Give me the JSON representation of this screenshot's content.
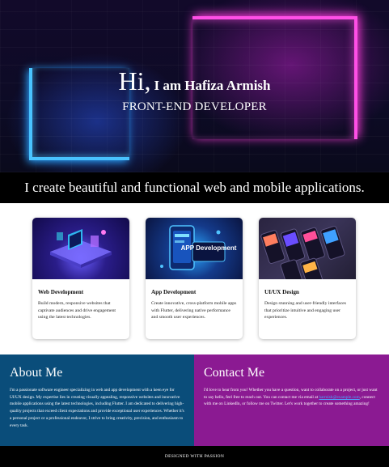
{
  "hero": {
    "greeting": "Hi,",
    "name": "I am Hafiza Armish",
    "role": "FRONT-END DEVELOPER"
  },
  "tagline": "I create beautiful and functional web and mobile applications.",
  "services": [
    {
      "title": "Web Development",
      "description": "Build modern, responsive websites that captivate audiences and drive engagement using the latest technologies."
    },
    {
      "title": "App Development",
      "description": "Create innovative, cross-platform mobile apps with Flutter, delivering native performance and smooth user experiences.",
      "image_text": "APP Development"
    },
    {
      "title": "UI/UX Design",
      "description": "Design stunning and user-friendly interfaces that prioritize intuitive and engaging user experiences."
    }
  ],
  "about": {
    "title": "About Me",
    "text": "I'm a passionate software engineer specializing in web and app development with a keen eye for UI/UX design. My expertise lies in creating visually appealing, responsive websites and innovative mobile applications using the latest technologies, including Flutter. I am dedicated to delivering high-quality projects that exceed client expectations and provide exceptional user experiences. Whether it's a personal project or a professional endeavor, I strive to bring creativity, precision, and enthusiasm to every task."
  },
  "contact": {
    "title": "Contact Me",
    "text_before": "I'd love to hear from you! Whether you have a question, want to collaborate on a project, or just want to say hello, feel free to reach out. You can contact me via email at ",
    "email": "harmish@example.com",
    "text_after": ", connect with me on LinkedIn, or follow me on Twitter. Let's work together to create something amazing!"
  },
  "footer": "DESIGNED WITH PASSION",
  "colors": {
    "about_bg": "#0a4d7a",
    "contact_bg": "#8b1a92",
    "neon_blue": "#49c3ff",
    "neon_pink": "#ff4fe6"
  }
}
